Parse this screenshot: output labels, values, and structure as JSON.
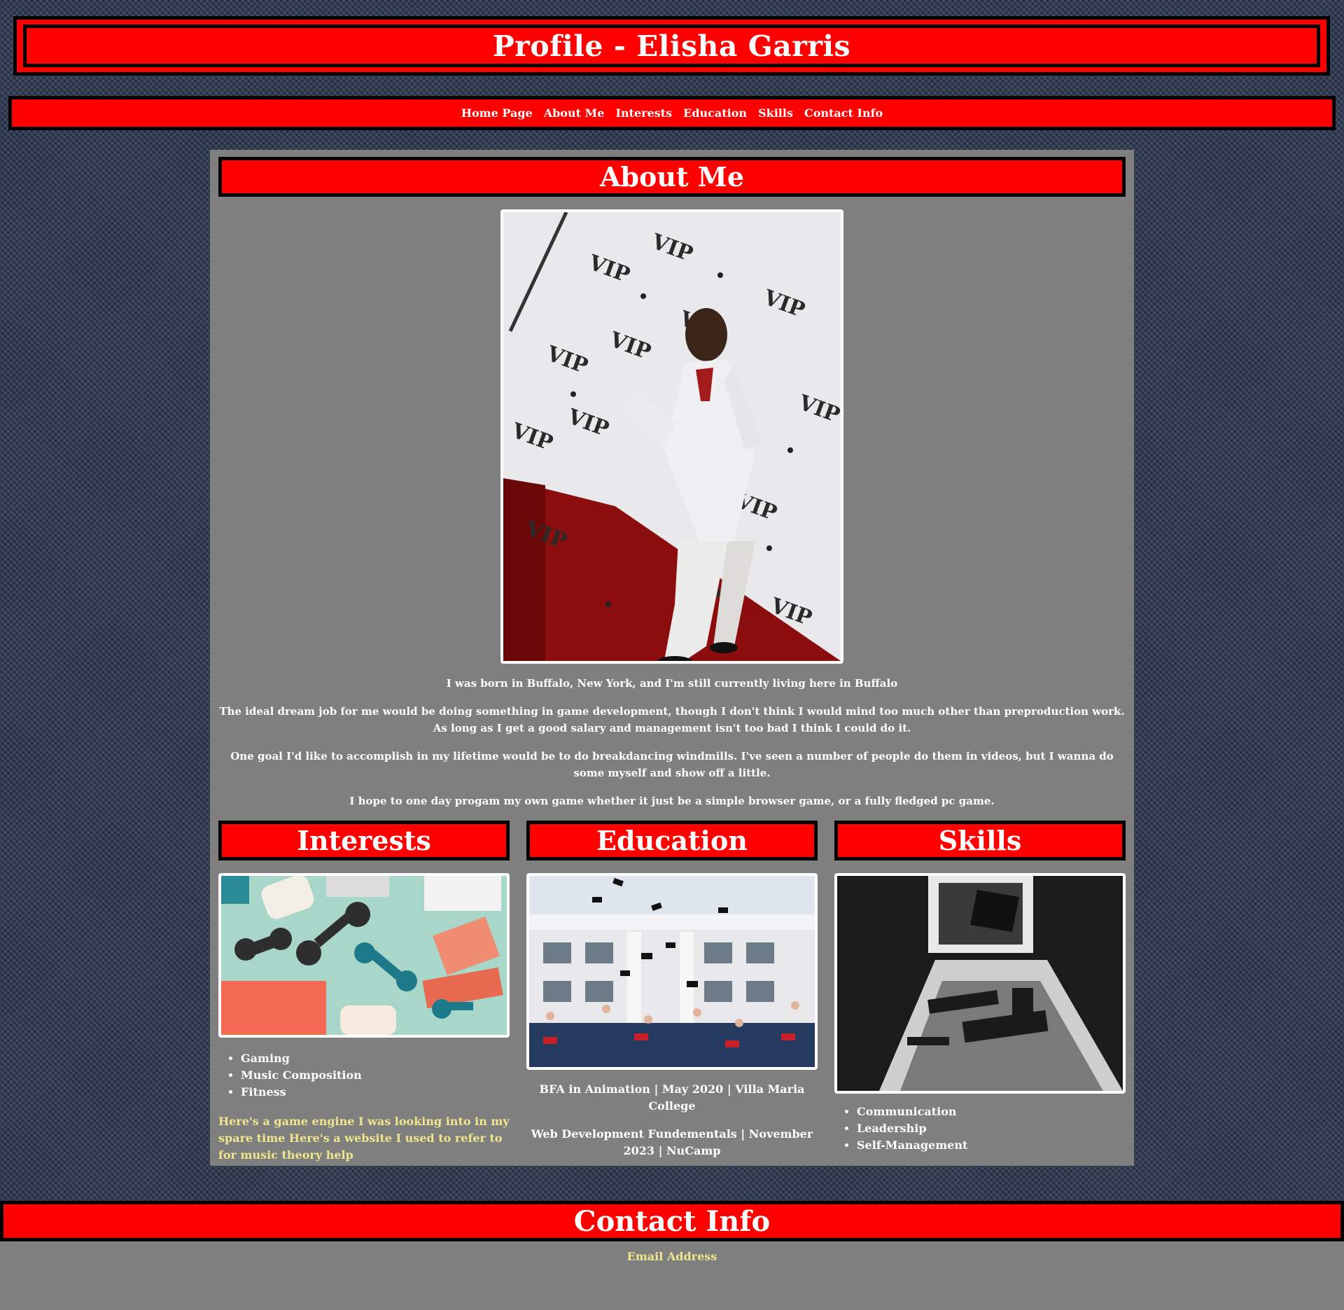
{
  "header": {
    "title": "Profile - Elisha Garris"
  },
  "nav": {
    "items": [
      "Home Page",
      "About Me",
      "Interests",
      "Education",
      "Skills",
      "Contact Info"
    ]
  },
  "about": {
    "title": "About Me",
    "photo_alt": "Portrait in white suit in front of VIP backdrop",
    "paragraphs": [
      "I was born in Buffalo, New York, and I'm still currently living here in Buffalo",
      "The ideal dream job for me would be doing something in game development, though I don't think I would mind too much other than preproduction work. As long as I get a good salary and management isn't too bad I think I could do it.",
      "One goal I'd like to accomplish in my lifetime would be to do breakdancing windmills. I've seen a number of people do them in videos, but I wanna do some myself and show off a little.",
      "I hope to one day progam my own game whether it just be a simple browser game, or a fully fledged pc game."
    ]
  },
  "interests": {
    "title": "Interests",
    "items": [
      "Gaming",
      "Music Composition",
      "Fitness"
    ],
    "link1": "Here's a game engine I was looking into in my spare time",
    "link2": "Here's a website I used to refer to for music theory help"
  },
  "education": {
    "title": "Education",
    "entries": [
      "BFA in Animation | May 2020 | Villa Maria College",
      "Web Development Fundementals | November 2023 | NuCamp"
    ]
  },
  "skills": {
    "title": "Skills",
    "items": [
      "Communication",
      "Leadership",
      "Self-Management"
    ]
  },
  "contact": {
    "title": "Contact Info",
    "email_label": "Email Address"
  },
  "colors": {
    "accent": "#ff0000",
    "panel": "#7f7f7f",
    "link": "#f0e68c",
    "background": "#2f3a52"
  }
}
